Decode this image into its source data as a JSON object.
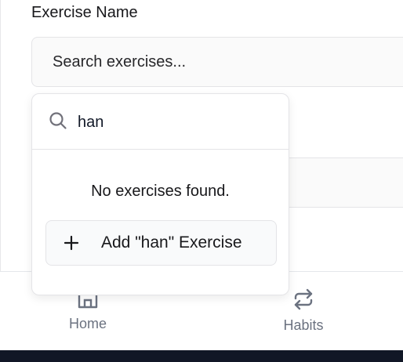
{
  "form": {
    "exercise_label": "Exercise Name",
    "exercise_placeholder": "Search exercises..."
  },
  "dropdown": {
    "search_value": "han",
    "empty_message": "No exercises found.",
    "add_label": "Add \"han\" Exercise"
  },
  "nav": {
    "items": [
      {
        "label": "Home",
        "icon": "home-icon"
      },
      {
        "label": "Habits",
        "icon": "repeat-icon"
      }
    ]
  },
  "colors": {
    "border": "#e4e4e7",
    "nav_text": "#6b7280",
    "footer": "#111726"
  }
}
